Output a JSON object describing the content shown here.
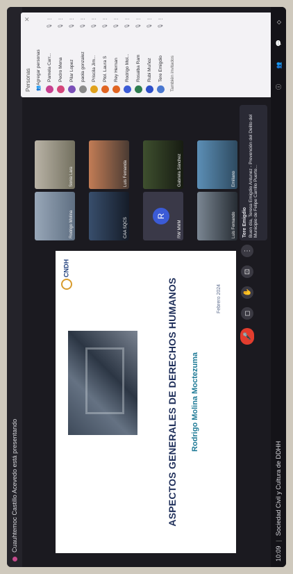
{
  "topbar": {
    "presenter_text": "Cuauhtemoc Castillo Acevedo está presentando"
  },
  "bottombar": {
    "time": "10:09",
    "meeting": "Sociedad Civil y Cultura de DDHH"
  },
  "slide": {
    "title": "ASPECTOS GENERALES DE DERECHOS HUMANOS",
    "name": "Rodrigo Molina Moctezuma",
    "date": "Febrero 2024",
    "logo": "CNDH"
  },
  "tiles": [
    {
      "label": "Rodrigo Molina",
      "style": "photo1"
    },
    {
      "label": "CAA SQCS",
      "style": "photo7"
    },
    {
      "label": "Sonia Lara",
      "style": "photo2"
    },
    {
      "label": "Luis Fernanda",
      "style": "photo3"
    },
    {
      "label": "RW MMM",
      "style": "avatar",
      "initial": "R"
    },
    {
      "label": "Gabriela Sánchez",
      "style": "photo4"
    },
    {
      "label": "Luis Fernando",
      "style": "photo5"
    },
    {
      "label": "Emiliano",
      "style": "photo6"
    }
  ],
  "chat": {
    "sender": "Tere Emigdio",
    "message": "Buen día, Teresa Emigdio Antunez - Prevención del Delito del Municipio de Felipe Carrillo Puerto..."
  },
  "people_panel": {
    "title": "Personas",
    "add_label": "Agregar personas",
    "footer": "También invitados",
    "people": [
      {
        "name": "Pamela Carr...",
        "color": "#c7408f"
      },
      {
        "name": "Pedro Mena",
        "color": "#d4457a"
      },
      {
        "name": "Pilar Lopez",
        "color": "#7a4fb8"
      },
      {
        "name": "paola gonzalez",
        "color": "#8a8a8a"
      },
      {
        "name": "Priscila Jim...",
        "color": "#e0a21d"
      },
      {
        "name": "Ptol. Laura S",
        "color": "#e06422"
      },
      {
        "name": "Rey Hernan",
        "color": "#e06422"
      },
      {
        "name": "Rodrigo Mol...",
        "color": "#3b5bd6"
      },
      {
        "name": "Rosalba Ram",
        "color": "#2e7d4f"
      },
      {
        "name": "Rubi Muñoz",
        "color": "#2d4fc9"
      },
      {
        "name": "Tere Emigdio",
        "color": "#4a78d0"
      }
    ]
  }
}
